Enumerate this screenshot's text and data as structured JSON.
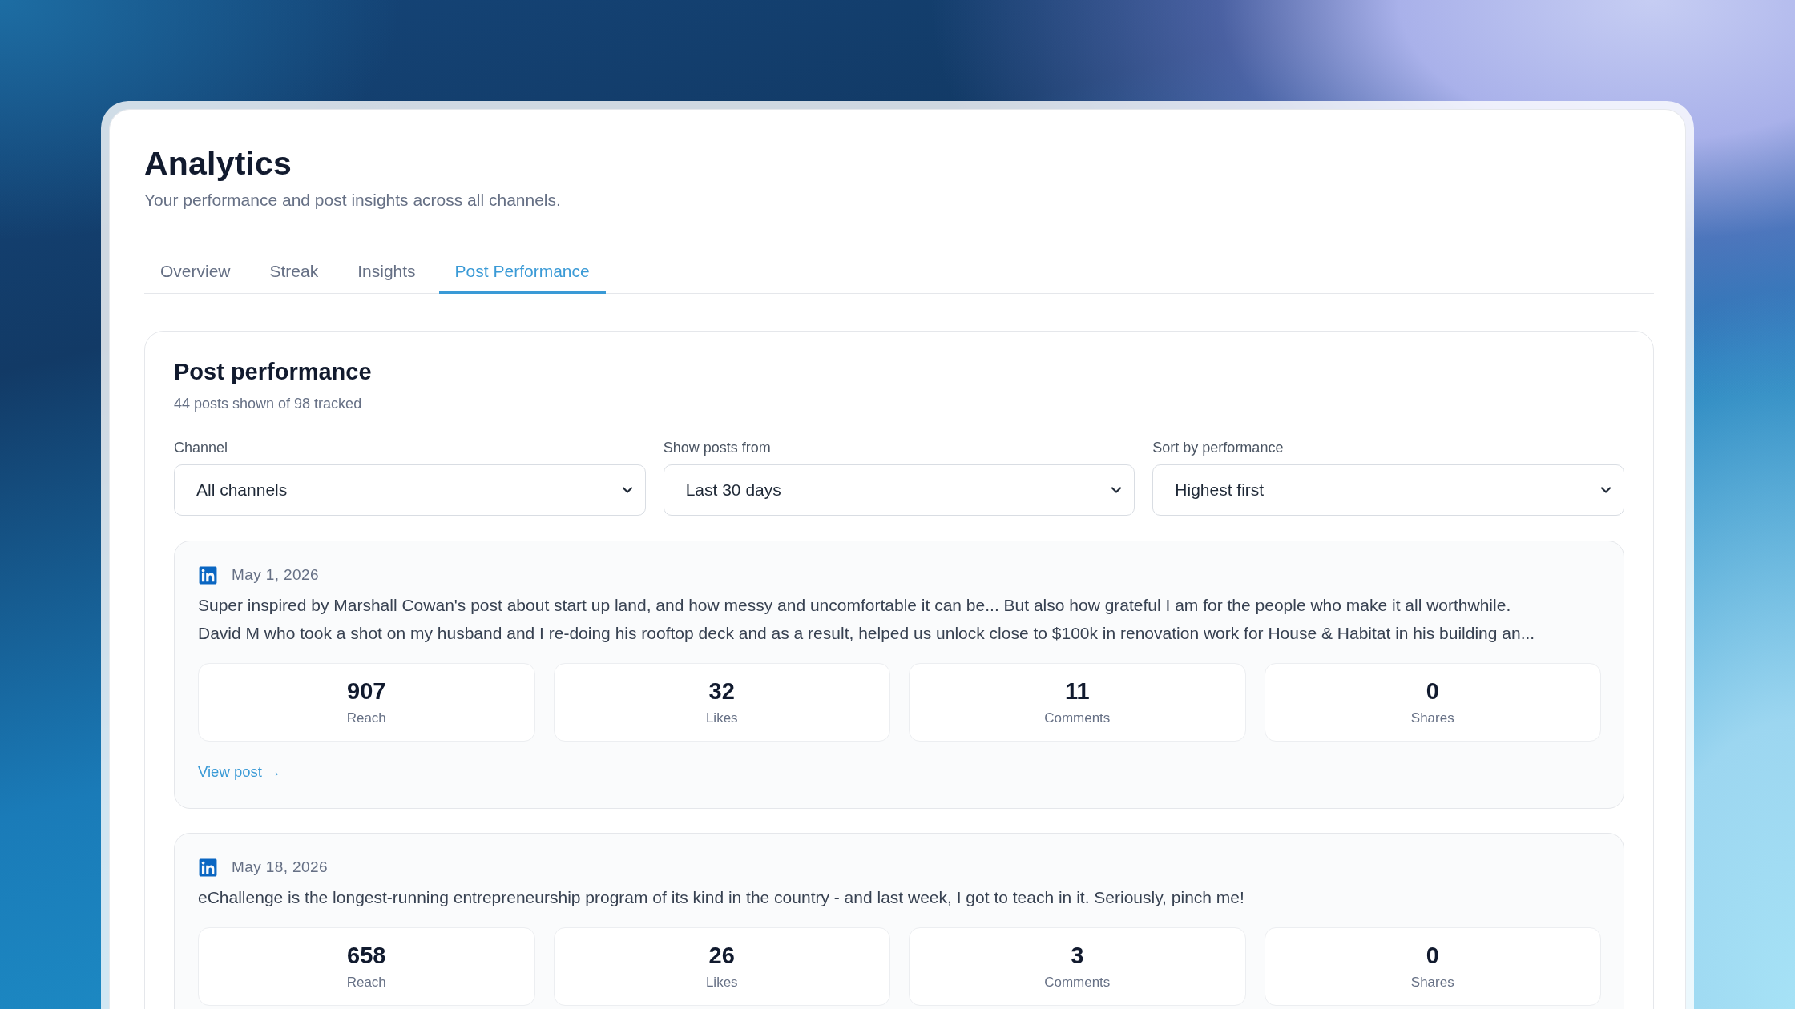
{
  "page": {
    "title": "Analytics",
    "subtitle": "Your performance and post insights across all channels."
  },
  "tabs": [
    {
      "label": "Overview",
      "selected": false
    },
    {
      "label": "Streak",
      "selected": false
    },
    {
      "label": "Insights",
      "selected": false
    },
    {
      "label": "Post Performance",
      "selected": true
    }
  ],
  "section": {
    "title": "Post performance",
    "summary": "44 posts shown of 98 tracked",
    "filters": [
      {
        "label": "Channel",
        "value": "All channels"
      },
      {
        "label": "Show posts from",
        "value": "Last 30 days"
      },
      {
        "label": "Sort by performance",
        "value": "Highest first"
      }
    ]
  },
  "posts": [
    {
      "date": "May 1, 2026",
      "text": "Super inspired by Marshall Cowan's post about start up land, and how messy and uncomfortable it can be... But also how grateful I am for the people who make it all worthwhile.\nDavid M who took a shot on my husband and I re-doing his rooftop deck and as a result, helped us unlock close to $100k in renovation work for House & Habitat in his building an...",
      "stats": [
        {
          "value": "907",
          "label": "Reach"
        },
        {
          "value": "32",
          "label": "Likes"
        },
        {
          "value": "11",
          "label": "Comments"
        },
        {
          "value": "0",
          "label": "Shares"
        }
      ],
      "link": "View post →"
    },
    {
      "date": "May 18, 2026",
      "text": "eChallenge is the longest-running entrepreneurship program of its kind in the country - and last week, I got to teach in it. Seriously, pinch me!",
      "stats": [
        {
          "value": "658",
          "label": "Reach"
        },
        {
          "value": "26",
          "label": "Likes"
        },
        {
          "value": "3",
          "label": "Comments"
        },
        {
          "value": "0",
          "label": "Shares"
        }
      ]
    }
  ]
}
